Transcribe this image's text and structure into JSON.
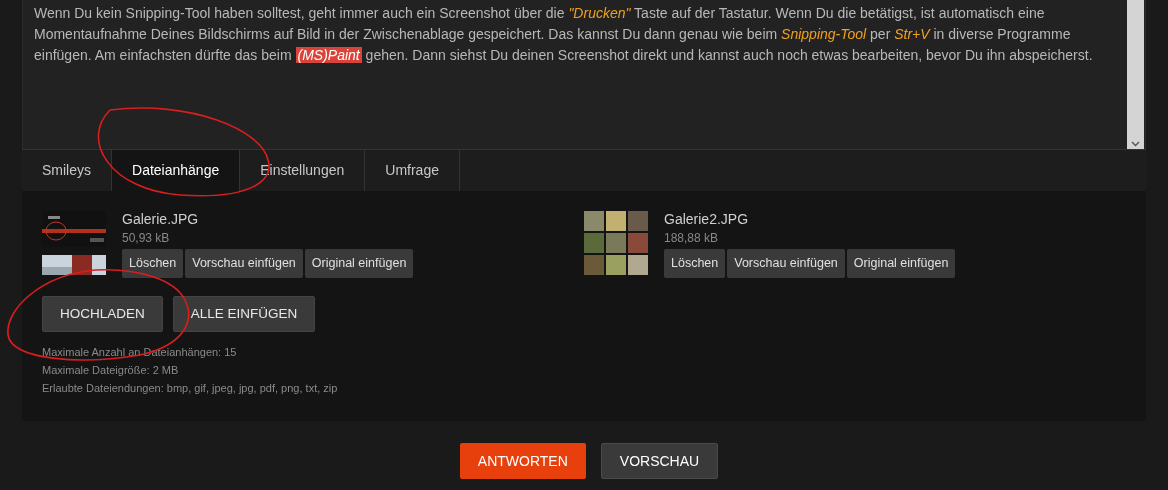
{
  "editor": {
    "paragraph": [
      {
        "kind": "plain",
        "text": "Wenn Du kein Snipping-Tool haben solltest, geht immer auch ein Screenshot über die "
      },
      {
        "kind": "emphasis",
        "text": "\"Drucken\""
      },
      {
        "kind": "plain",
        "text": " Taste auf der Tastatur. Wenn Du die betätigst, ist automatisch eine Momentaufnahme Deines Bildschirms auf Bild in der Zwischenablage gespeichert. Das kannst Du dann genau wie beim "
      },
      {
        "kind": "emphasis",
        "text": "Snipping-Tool"
      },
      {
        "kind": "plain",
        "text": " per "
      },
      {
        "kind": "emphasis",
        "text": "Str+V"
      },
      {
        "kind": "plain",
        "text": " in diverse Programme einfügen. Am einfachsten dürfte das beim "
      },
      {
        "kind": "highlight",
        "text": "(MS)Paint"
      },
      {
        "kind": "plain",
        "text": " gehen. Dann siehst Du deinen Screenshot direkt und kannst auch noch etwas bearbeiten, bevor Du ihn abspeicherst."
      }
    ]
  },
  "tabs": [
    {
      "label": "Smileys",
      "selected": false
    },
    {
      "label": "Dateianhänge",
      "selected": true
    },
    {
      "label": "Einstellungen",
      "selected": false
    },
    {
      "label": "Umfrage",
      "selected": false
    }
  ],
  "attachments": [
    {
      "name": "Galerie.JPG",
      "size": "50,93 kB",
      "buttons": [
        "Löschen",
        "Vorschau einfügen",
        "Original einfügen"
      ]
    },
    {
      "name": "Galerie2.JPG",
      "size": "188,88 kB",
      "buttons": [
        "Löschen",
        "Vorschau einfügen",
        "Original einfügen"
      ]
    }
  ],
  "upload_buttons": [
    "HOCHLADEN",
    "ALLE EINFÜGEN"
  ],
  "limits": [
    "Maximale Anzahl an Dateianhängen: 15",
    "Maximale Dateigröße: 2 MB",
    "Erlaubte Dateiendungen: bmp, gif, jpeg, jpg, pdf, png, txt, zip"
  ],
  "actions": [
    {
      "label": "ANTWORTEN",
      "kind": "primary"
    },
    {
      "label": "VORSCHAU",
      "kind": "secondary"
    }
  ]
}
